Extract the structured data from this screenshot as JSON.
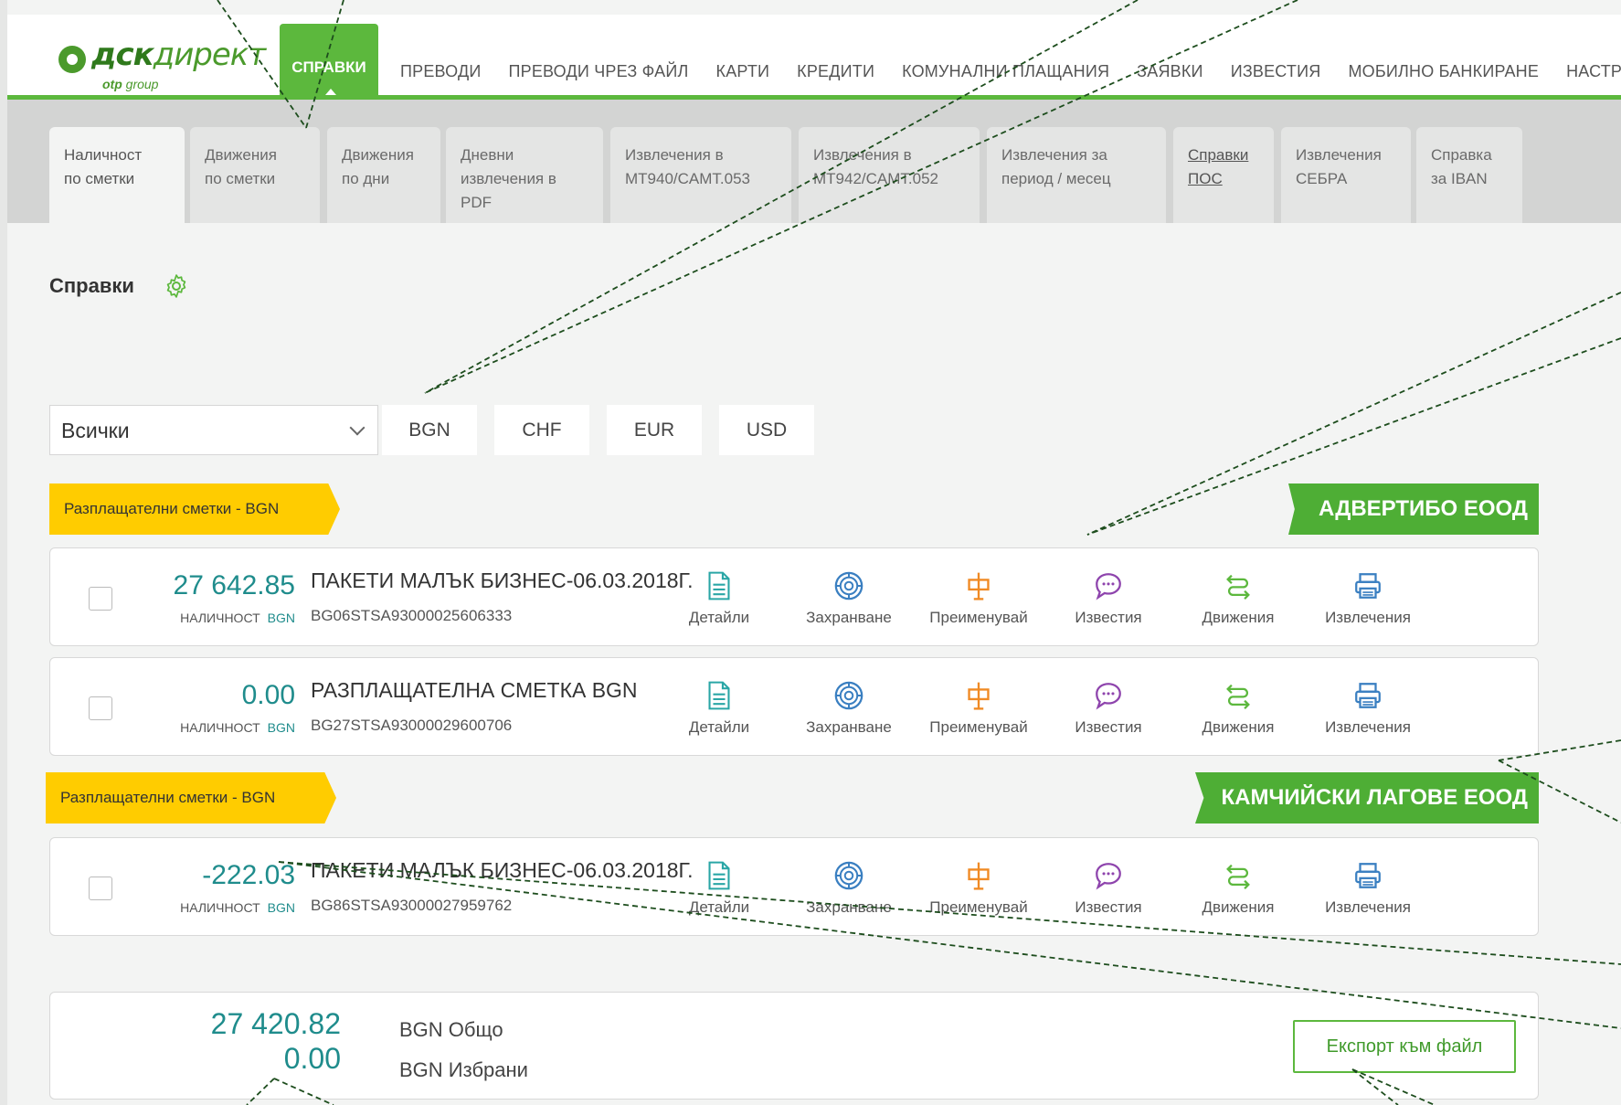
{
  "logo": {
    "brand_bold": "дск",
    "brand_italic": "директ",
    "sub_bold": "otp",
    "sub_rest": " group"
  },
  "nav": {
    "active": "СПРАВКИ",
    "items": [
      "ПРЕВОДИ",
      "ПРЕВОДИ ЧРЕЗ ФАЙЛ",
      "КАРТИ",
      "КРЕДИТИ",
      "КОМУНАЛНИ ПЛАЩАНИЯ",
      "ЗАЯВКИ",
      "ИЗВЕСТИЯ",
      "МОБИЛНО БАНКИРАНЕ",
      "НАСТРОЙКИ"
    ]
  },
  "tabs": [
    {
      "line1": "Наличност",
      "line2": "по сметки",
      "line3": ""
    },
    {
      "line1": "Движения",
      "line2": "по сметки",
      "line3": ""
    },
    {
      "line1": "Движения",
      "line2": "по дни",
      "line3": ""
    },
    {
      "line1": "Дневни",
      "line2": "извлечения в",
      "line3": "PDF"
    },
    {
      "line1": "Извлечения в",
      "line2": "MT940/CAMT.053",
      "line3": ""
    },
    {
      "line1": "Извлечения в",
      "line2": "MT942/CAMT.052",
      "line3": ""
    },
    {
      "line1": "Извлечения за",
      "line2": "период / месец",
      "line3": ""
    },
    {
      "line1": "Справки",
      "line2": "ПОС",
      "line3": ""
    },
    {
      "line1": "Извлечения",
      "line2": "СЕБРА",
      "line3": ""
    },
    {
      "line1": "Справка",
      "line2": "за IBAN",
      "line3": ""
    }
  ],
  "page_title": "Справки",
  "filter": {
    "select_value": "Всички",
    "currencies": [
      "BGN",
      "CHF",
      "EUR",
      "USD"
    ]
  },
  "groups": [
    {
      "category": "Разплащателни сметки - BGN",
      "company": "АДВЕРТИБО ЕООД",
      "accounts": [
        {
          "amount": "27 642.85",
          "label": "НАЛИЧНОСТ",
          "ccy": "BGN",
          "name": "ПАКЕТИ МАЛЪК БИЗНЕС-06.03.2018Г.",
          "iban": "BG06STSA93000025606333"
        },
        {
          "amount": "0.00",
          "label": "НАЛИЧНОСТ",
          "ccy": "BGN",
          "name": "РАЗПЛАЩАТЕЛНА СМЕТКА BGN",
          "iban": "BG27STSA93000029600706"
        }
      ]
    },
    {
      "category": "Разплащателни сметки - BGN",
      "company": "КАМЧИЙСКИ ЛАГОВЕ ЕООД",
      "accounts": [
        {
          "amount": "-222.03",
          "label": "НАЛИЧНОСТ",
          "ccy": "BGN",
          "name": "ПАКЕТИ МАЛЪК БИЗНЕС-06.03.2018Г.",
          "iban": "BG86STSA93000027959762"
        }
      ]
    }
  ],
  "actions": [
    "Детайли",
    "Захранване",
    "Преименувай",
    "Известия",
    "Движения",
    "Извлечения"
  ],
  "colors": {
    "green": "#5cb83d",
    "teal": "#1f8c8c",
    "yellow": "#ffcc00",
    "orange": "#f08a24",
    "purple": "#8e44ad",
    "blue": "#3a7fc1"
  },
  "totals": {
    "total_amount": "27 420.82",
    "total_label": "BGN Общо",
    "selected_amount": "0.00",
    "selected_label": "BGN Избрани",
    "export_label": "Експорт към файл"
  }
}
